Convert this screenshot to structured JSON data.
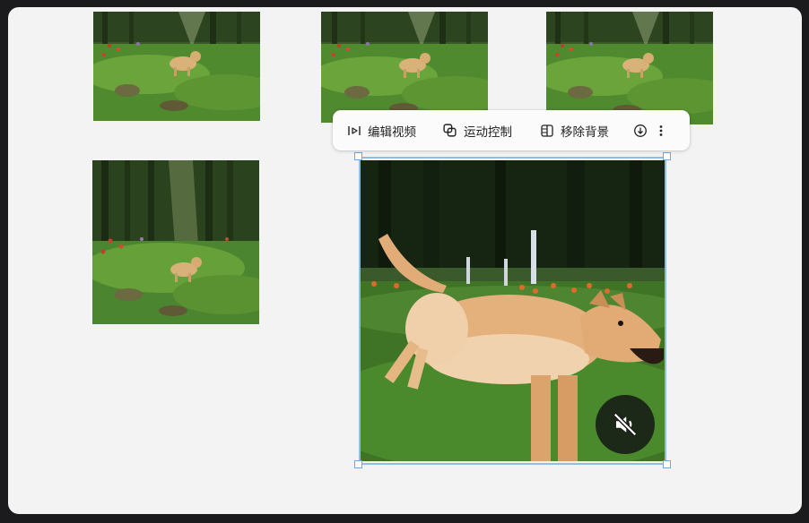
{
  "toolbar": {
    "edit_video_label": "编辑视频",
    "motion_control_label": "运动控制",
    "remove_background_label": "移除背景"
  },
  "icons": {
    "edit_video": "edit-video-icon",
    "motion_control": "motion-control-icon",
    "remove_background": "remove-background-icon",
    "download": "download-icon",
    "more": "more-vertical-icon",
    "mute": "muted-speaker-icon"
  },
  "colors": {
    "canvas_bg": "#f3f3f4",
    "selection_border": "#8fbce8",
    "toolbar_bg": "#fbfbfb"
  }
}
